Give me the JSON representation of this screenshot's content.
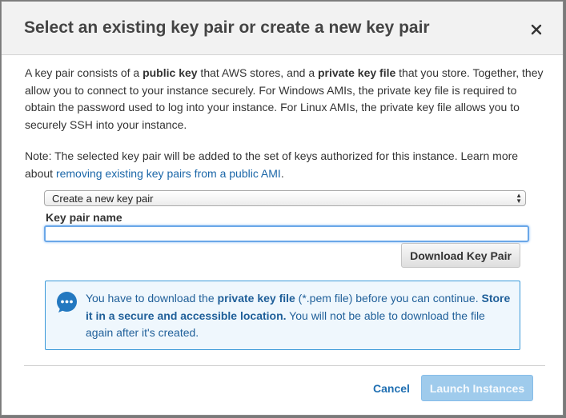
{
  "dialog": {
    "title": "Select an existing key pair or create a new key pair"
  },
  "description": {
    "p1_a": "A key pair consists of a ",
    "p1_b": "public key",
    "p1_c": " that AWS stores, and a ",
    "p1_d": "private key file",
    "p1_e": " that you store. Together, they allow you to connect to your instance securely. For Windows AMIs, the private key file is required to obtain the password used to log into your instance. For Linux AMIs, the private key file allows you to securely SSH into your instance."
  },
  "note": {
    "text": "Note: The selected key pair will be added to the set of keys authorized for this instance. Learn more about ",
    "link": "removing existing key pairs from a public AMI",
    "end": "."
  },
  "form": {
    "select_value": "Create a new key pair",
    "key_pair_label": "Key pair name",
    "key_pair_value": "",
    "download_button": "Download Key Pair"
  },
  "info": {
    "a": "You have to download the ",
    "b": "private key file",
    "c": " (*.pem file) before you can continue. ",
    "d": "Store it in a secure and accessible location.",
    "e": " You will not be able to download the file again after it's created."
  },
  "footer": {
    "cancel": "Cancel",
    "launch": "Launch Instances"
  },
  "colors": {
    "accent": "#1f6fb2",
    "info_border": "#3b9ad9",
    "launch_disabled": "#9fcbec"
  }
}
